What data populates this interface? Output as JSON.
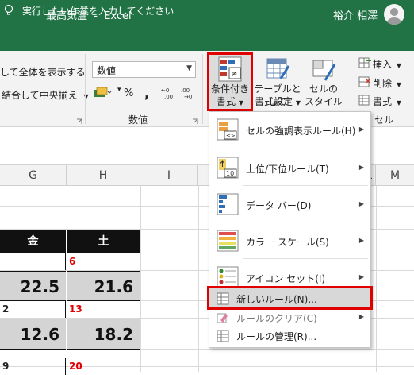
{
  "window": {
    "title": "最高気温  -  Excel",
    "user": "裕介 相澤"
  },
  "tellme": {
    "text": "実行したい作業を入力してください"
  },
  "ribbon": {
    "alignment": {
      "shrink_label": "して全体を表示する",
      "merge_label": "結合して中央揃え"
    },
    "number": {
      "format_value": "数値",
      "percent": "%",
      "comma": ",",
      "group_label": "数値"
    },
    "styles": {
      "cf_label_1": "条件付き",
      "cf_label_2": "書式",
      "table_label_1": "テーブルとして",
      "table_label_2": "書式設定",
      "cell_label_1": "セルの",
      "cell_label_2": "スタイル"
    },
    "cells": {
      "insert": "挿入",
      "delete": "削除",
      "format": "書式",
      "group_label": "セル"
    }
  },
  "columns": [
    "G",
    "H",
    "I",
    "L",
    "M"
  ],
  "sheet": {
    "days": [
      "金",
      "土"
    ],
    "row_a": {
      "g": "",
      "h": "6"
    },
    "row_b": {
      "g": "22.5",
      "h": "21.6"
    },
    "row_c": {
      "g": "2",
      "h": "13"
    },
    "row_d": {
      "g": "12.6",
      "h": "18.2"
    },
    "row_e": {
      "g": "9",
      "h": "20"
    }
  },
  "menu": {
    "items": [
      {
        "label": "セルの強調表示ルール(H)",
        "icon": "highlight-rules-icon"
      },
      {
        "label": "上位/下位ルール(T)",
        "icon": "top-bottom-icon"
      },
      {
        "label": "データ バー(D)",
        "icon": "data-bars-icon"
      },
      {
        "label": "カラー スケール(S)",
        "icon": "color-scales-icon"
      },
      {
        "label": "アイコン セット(I)",
        "icon": "icon-sets-icon"
      }
    ],
    "new_rule": "新しいルール(N)...",
    "clear_rules": "ルールのクリア(C)",
    "manage_rules": "ルールの管理(R)..."
  },
  "colors": {
    "excel_green": "#217346",
    "highlight_red": "#e00000"
  }
}
